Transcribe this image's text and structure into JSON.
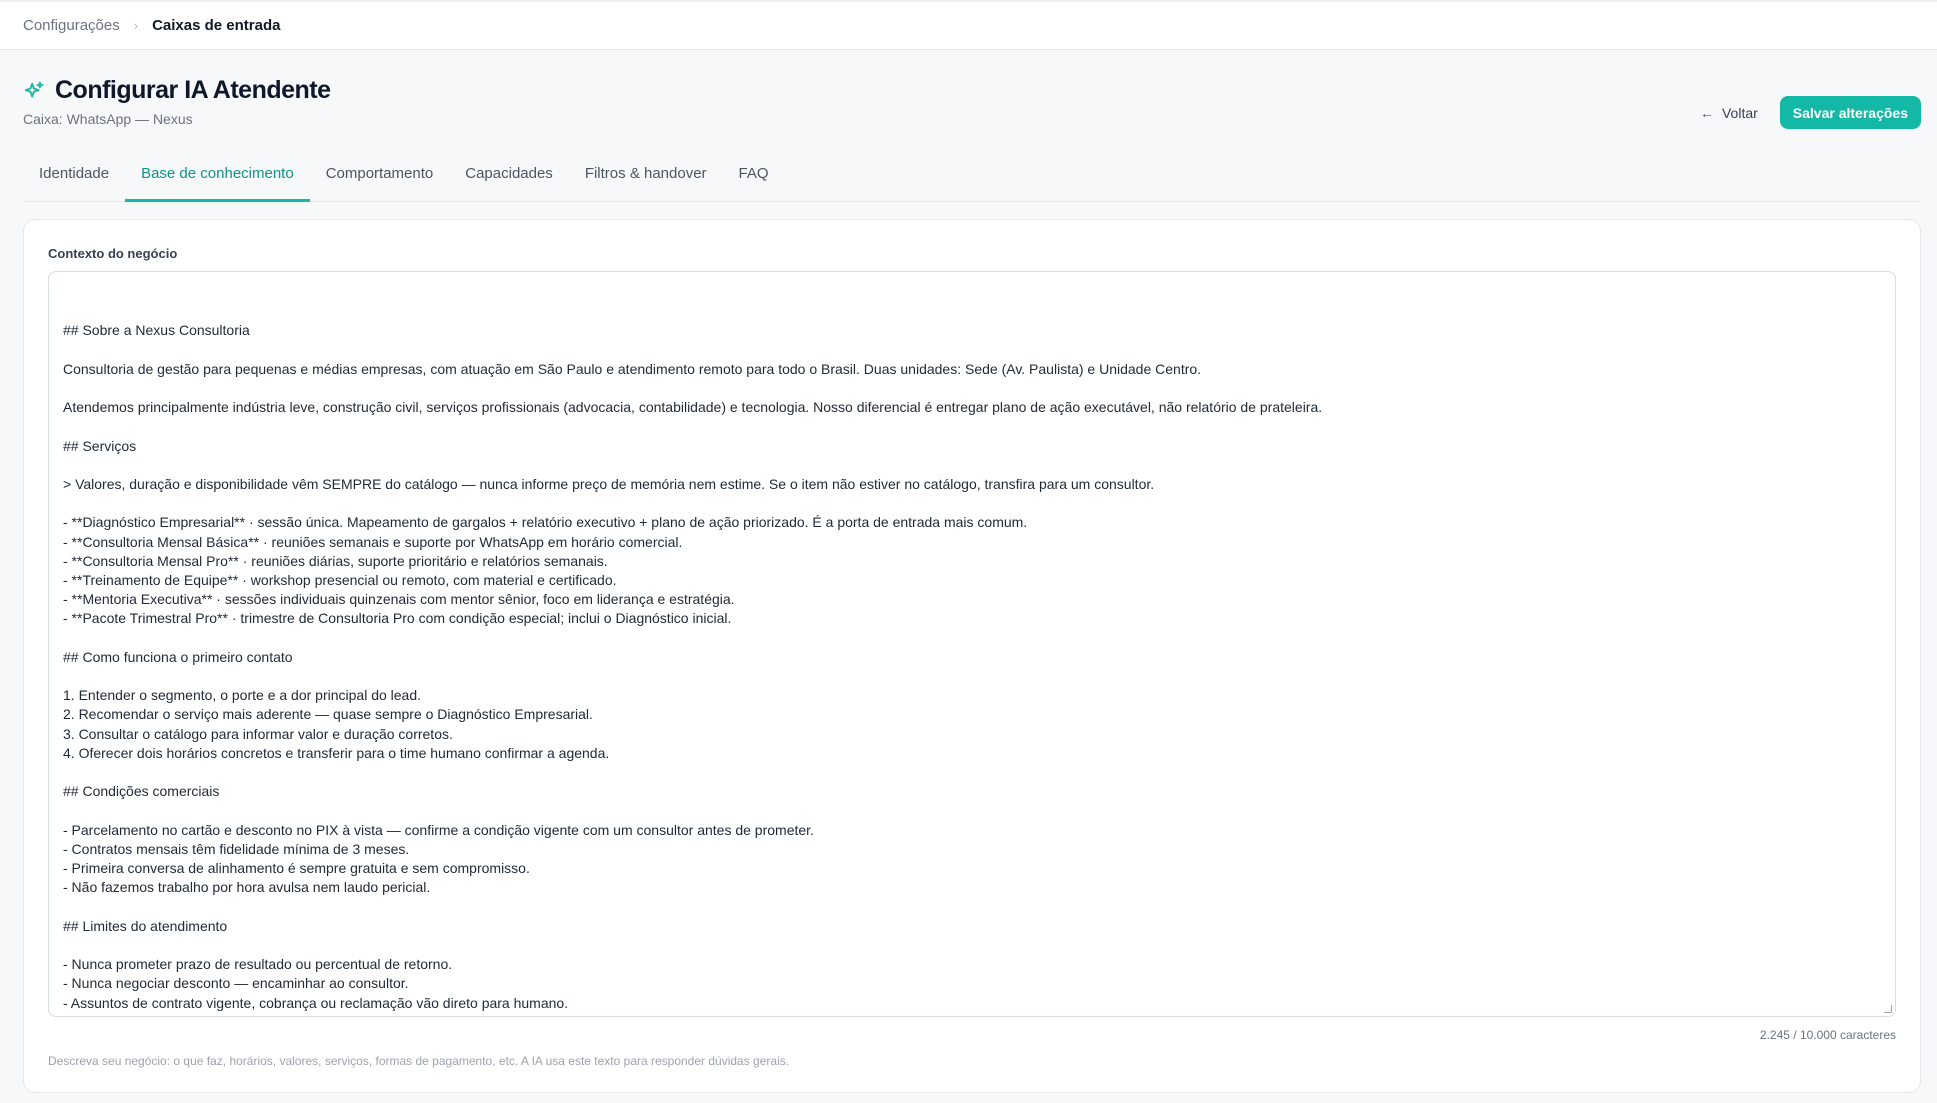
{
  "breadcrumb": {
    "parent": "Configurações",
    "separator": "›",
    "current": "Caixas de entrada"
  },
  "header": {
    "icon": "sparkles-icon",
    "title": "Configurar IA Atendente",
    "subtitle": "Caixa: WhatsApp — Nexus",
    "back_label": "Voltar",
    "save_label": "Salvar alterações"
  },
  "tabs": [
    {
      "label": "Identidade",
      "active": false
    },
    {
      "label": "Base de conhecimento",
      "active": true
    },
    {
      "label": "Comportamento",
      "active": false
    },
    {
      "label": "Capacidades",
      "active": false
    },
    {
      "label": "Filtros & handover",
      "active": false
    },
    {
      "label": "FAQ",
      "active": false
    }
  ],
  "form": {
    "label": "Contexto do negócio",
    "value": "## Sobre a Nexus Consultoria\n\nConsultoria de gestão para pequenas e médias empresas, com atuação em São Paulo e atendimento remoto para todo o Brasil. Duas unidades: Sede (Av. Paulista) e Unidade Centro.\n\nAtendemos principalmente indústria leve, construção civil, serviços profissionais (advocacia, contabilidade) e tecnologia. Nosso diferencial é entregar plano de ação executável, não relatório de prateleira.\n\n## Serviços\n\n> Valores, duração e disponibilidade vêm SEMPRE do catálogo — nunca informe preço de memória nem estime. Se o item não estiver no catálogo, transfira para um consultor.\n\n- **Diagnóstico Empresarial** · sessão única. Mapeamento de gargalos + relatório executivo + plano de ação priorizado. É a porta de entrada mais comum.\n- **Consultoria Mensal Básica** · reuniões semanais e suporte por WhatsApp em horário comercial.\n- **Consultoria Mensal Pro** · reuniões diárias, suporte prioritário e relatórios semanais.\n- **Treinamento de Equipe** · workshop presencial ou remoto, com material e certificado.\n- **Mentoria Executiva** · sessões individuais quinzenais com mentor sênior, foco em liderança e estratégia.\n- **Pacote Trimestral Pro** · trimestre de Consultoria Pro com condição especial; inclui o Diagnóstico inicial.\n\n## Como funciona o primeiro contato\n\n1. Entender o segmento, o porte e a dor principal do lead.\n2. Recomendar o serviço mais aderente — quase sempre o Diagnóstico Empresarial.\n3. Consultar o catálogo para informar valor e duração corretos.\n4. Oferecer dois horários concretos e transferir para o time humano confirmar a agenda.\n\n## Condições comerciais\n\n- Parcelamento no cartão e desconto no PIX à vista — confirme a condição vigente com um consultor antes de prometer.\n- Contratos mensais têm fidelidade mínima de 3 meses.\n- Primeira conversa de alinhamento é sempre gratuita e sem compromisso.\n- Não fazemos trabalho por hora avulsa nem laudo pericial.\n\n## Limites do atendimento\n\n- Nunca prometer prazo de resultado ou percentual de retorno.\n- Nunca negociar desconto — encaminhar ao consultor.\n- Assuntos de contrato vigente, cobrança ou reclamação vão direto para humano.\n- Se o lead pedir algo fora do escopo (jurídico, contábil, auditoria), explicar que não atendemos e oferecer indicação.",
    "char_count": "2.245 / 10.000 caracteres",
    "help": "Descreva seu negócio: o que faz, horários, valores, serviços, formas de pagamento, etc. A IA usa este texto para responder dúvidas gerais."
  },
  "colors": {
    "accent": "#14b8a6",
    "accent_text": "#0d9488"
  }
}
